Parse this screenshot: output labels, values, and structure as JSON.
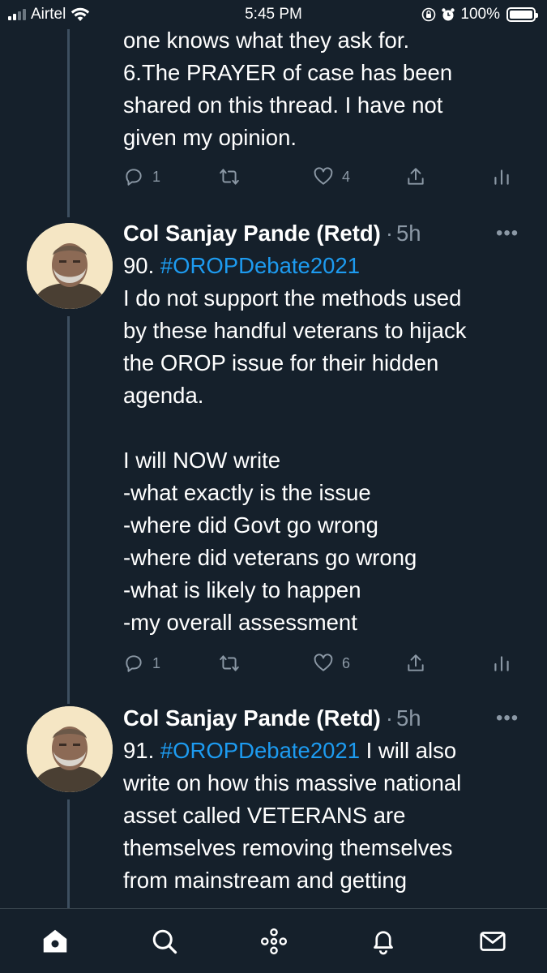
{
  "status_bar": {
    "carrier": "Airtel",
    "time": "5:45 PM",
    "battery": "100%"
  },
  "thread": {
    "top_tweet": {
      "text": "one knows what they ask for.\n6.The PRAYER of case has been\nshared on this thread. I have not\ngiven my opinion.",
      "reply_count": "1",
      "like_count": "4"
    },
    "tweets": [
      {
        "author": "Col Sanjay Pande (Retd)",
        "separator": "·",
        "time_ago": "5h",
        "prefix": "90.  ",
        "hashtag": "#OROPDebate2021",
        "text": "I do not support the methods used\nby these handful veterans to hijack\nthe OROP issue for their hidden\nagenda.\n\nI will NOW write\n-what exactly is the issue\n-where did Govt go wrong\n-where did veterans go wrong\n-what is likely to happen\n-my overall assessment",
        "reply_count": "1",
        "like_count": "6"
      },
      {
        "author": "Col Sanjay Pande (Retd)",
        "separator": "·",
        "time_ago": "5h",
        "prefix": "91. ",
        "hashtag": "#OROPDebate2021",
        "inline_text": " I will also",
        "text": "write on how this massive national\nasset called VETERANS are\nthemselves removing themselves\nfrom mainstream and getting"
      }
    ]
  },
  "bottom_nav": [
    "home-icon",
    "search-icon",
    "spaces-icon",
    "notifications-icon",
    "messages-icon"
  ],
  "colors": {
    "background": "#15202b",
    "link": "#1d9bf0",
    "muted": "#8b98a5"
  }
}
